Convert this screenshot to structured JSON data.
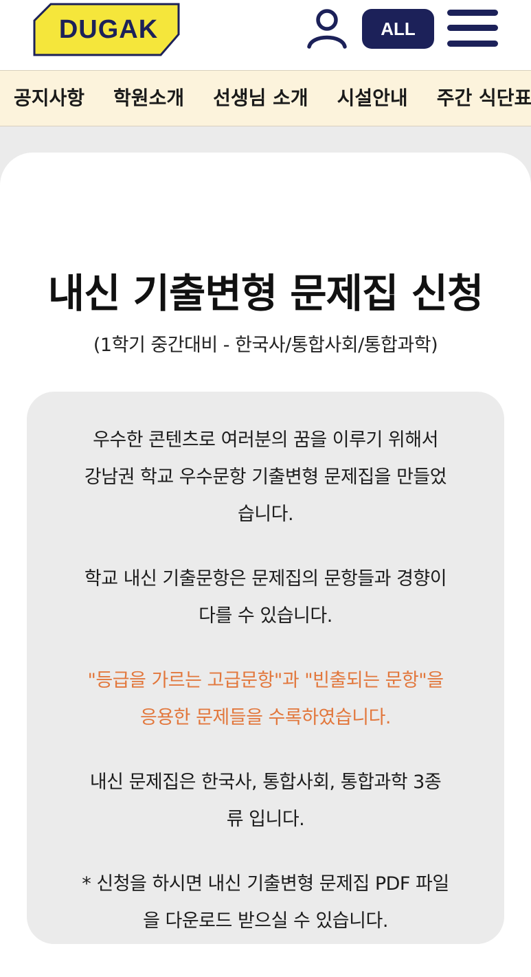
{
  "header": {
    "logo_text": "DUGAK",
    "user_icon": "user-icon",
    "all_button_label": "ALL",
    "menu_icon": "hamburger-menu-icon",
    "colors": {
      "navy": "#1c2159",
      "logo_yellow": "#f5e63b"
    }
  },
  "nav": {
    "items": [
      {
        "label": "공지사항"
      },
      {
        "label": "학원소개"
      },
      {
        "label": "선생님 소개"
      },
      {
        "label": "시설안내"
      },
      {
        "label": "주간 식단표"
      }
    ],
    "background": "#fcf3dc"
  },
  "main": {
    "title": "내신 기출변형 문제집 신청",
    "subtitle": "(1학기 중간대비 - 한국사/통합사회/통합과학)",
    "info": {
      "paragraphs": [
        {
          "lines": [
            "우수한 콘텐츠로 여러분의 꿈을 이루기 위해서",
            "강남권 학교 우수문항 기출변형 문제집을 만들었",
            "습니다."
          ]
        },
        {
          "lines": [
            "학교 내신 기출문항은 문제집의 문항들과 경향이",
            "다를 수 있습니다."
          ]
        },
        {
          "lines": [
            "\"등급을 가르는 고급문항\"과 \"빈출되는 문항\"을",
            "응용한 문제들을 수록하였습니다."
          ],
          "color": "#e2773c"
        },
        {
          "lines": [
            "내신 문제집은 한국사, 통합사회, 통합과학 3종",
            "류 입니다."
          ]
        },
        {
          "lines": [
            "* 신청을 하시면 내신 기출변형 문제집 PDF 파일",
            "을 다운로드 받으실 수 있습니다."
          ]
        }
      ]
    }
  }
}
